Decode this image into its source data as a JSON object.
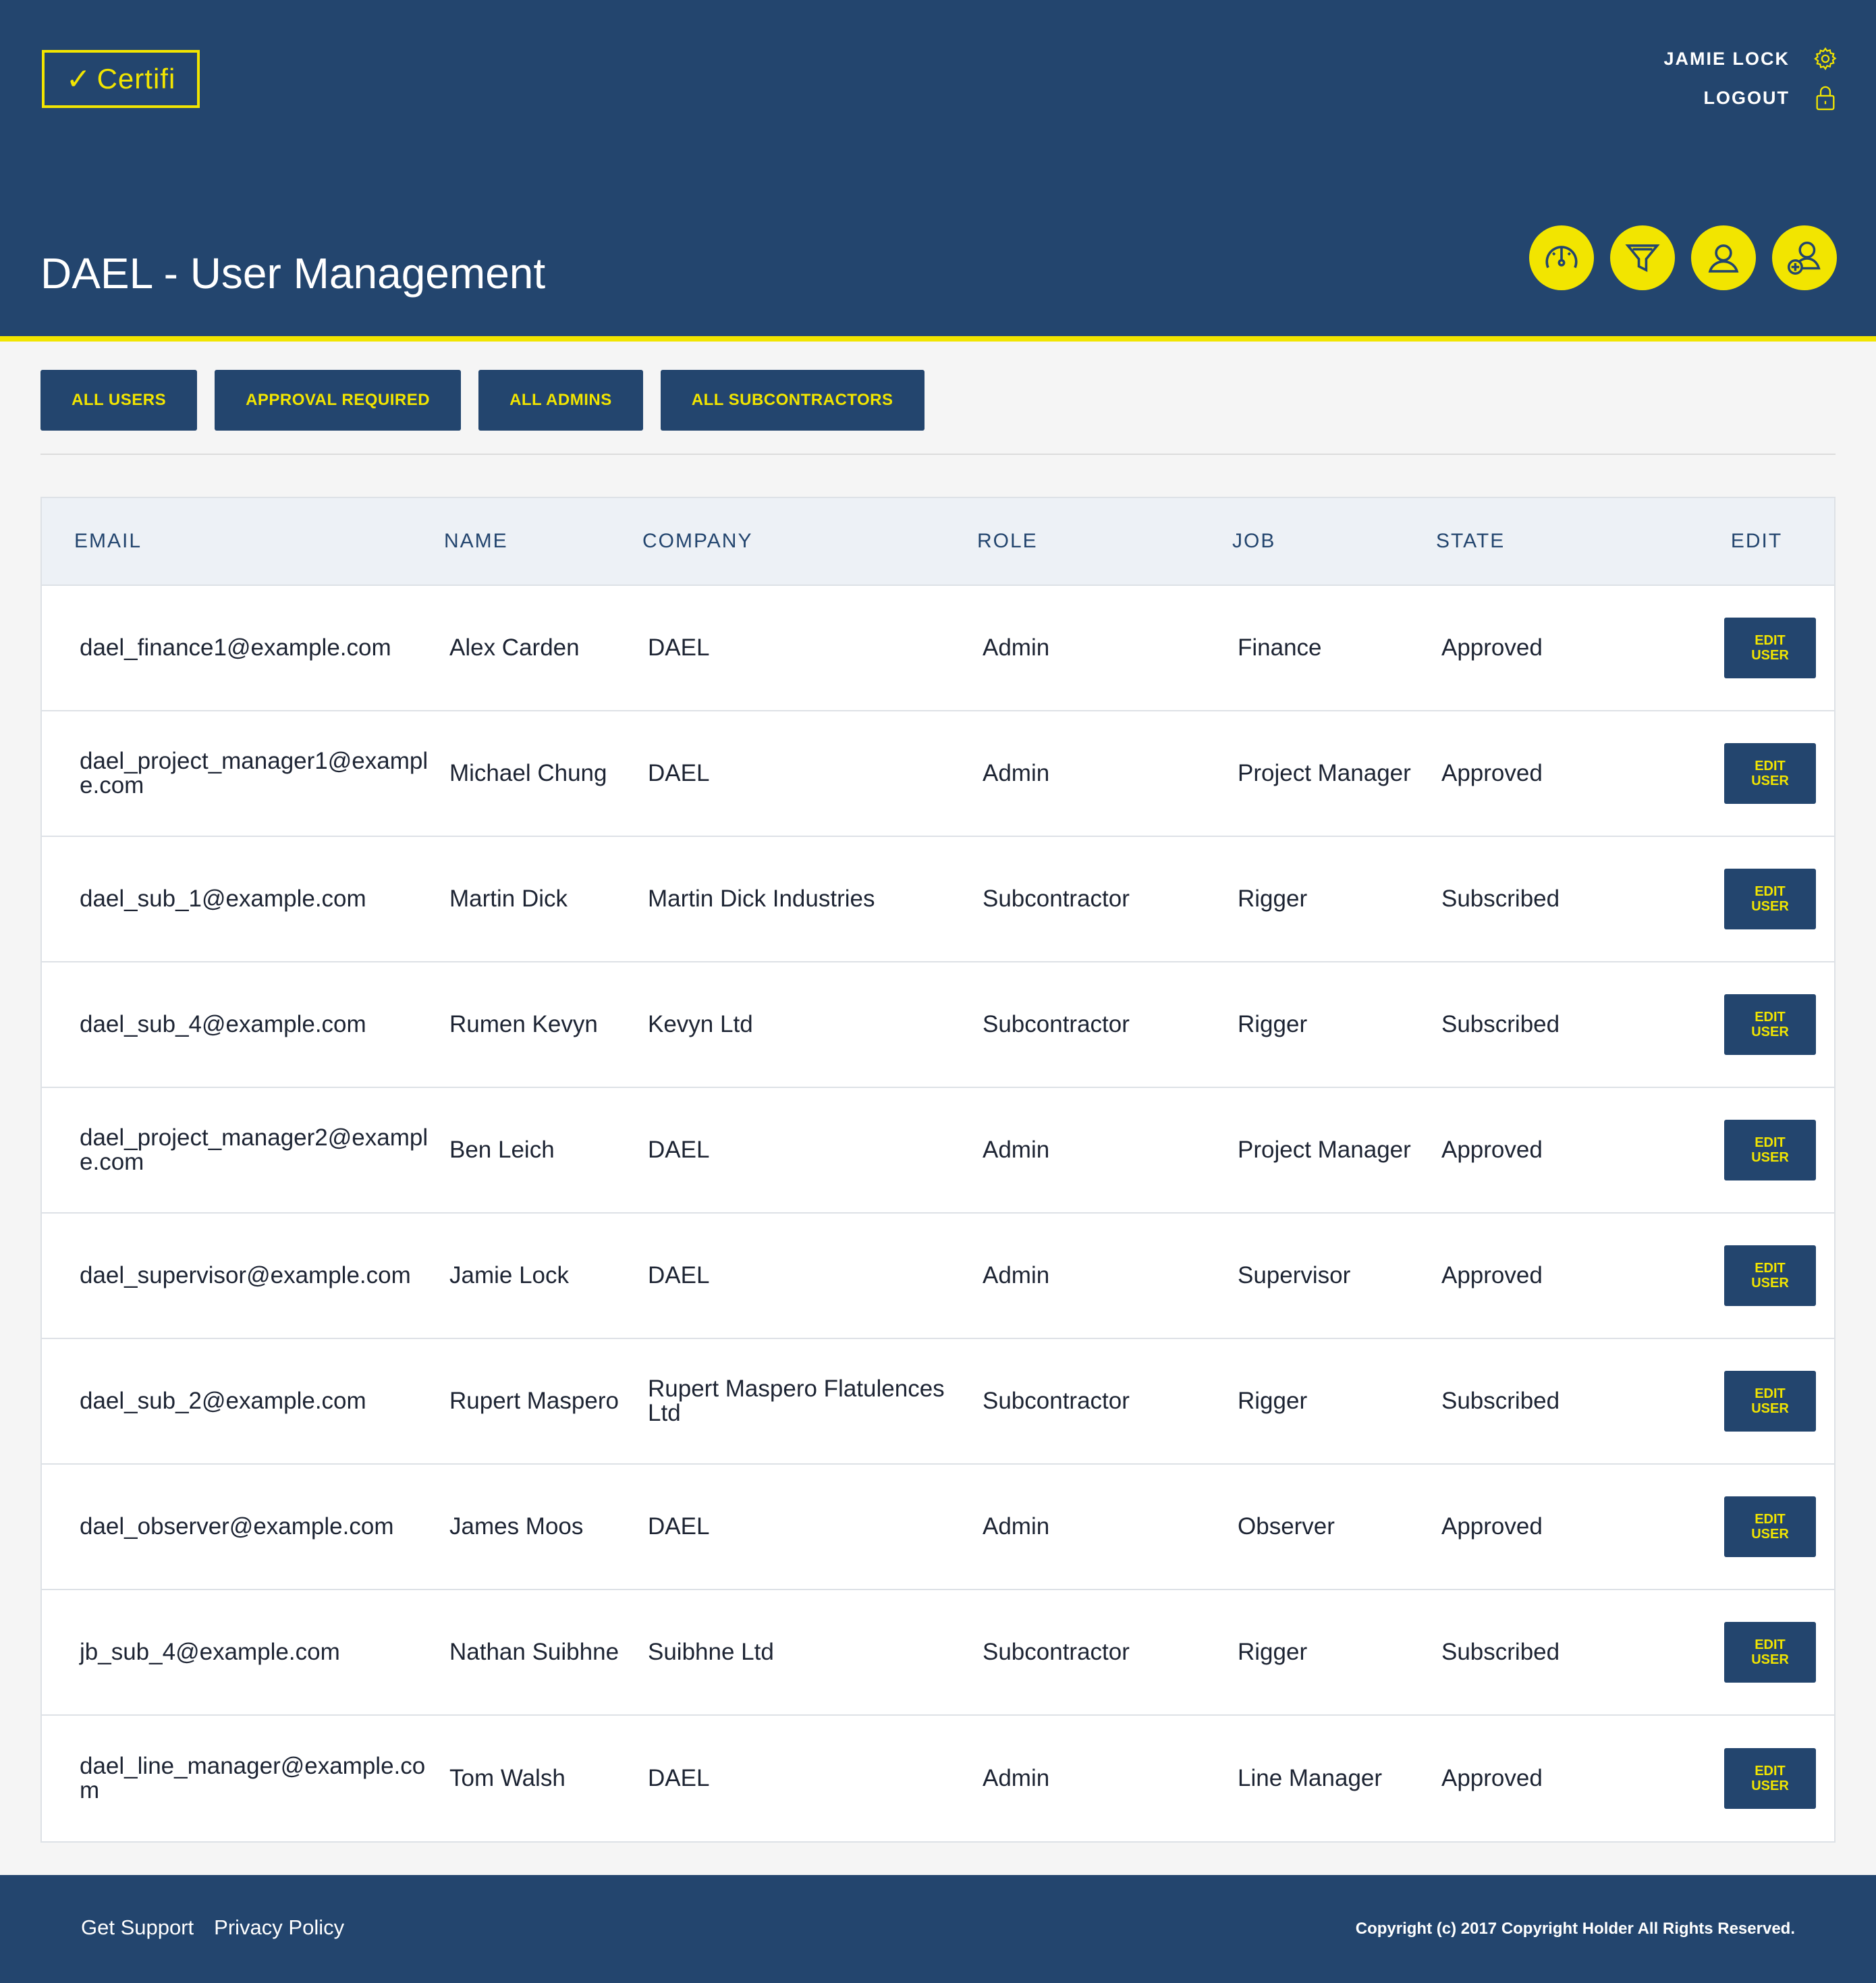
{
  "brand": {
    "logo_text": "Certifi",
    "accent": "#f2e500",
    "primary": "#23456e"
  },
  "user_menu": {
    "username": "JAMIE LOCK",
    "logout": "LOGOUT"
  },
  "page_title": "DAEL - User Management",
  "header_icons": [
    "dashboard-icon",
    "filter-icon",
    "user-icon",
    "add-user-icon"
  ],
  "tabs": [
    "ALL USERS",
    "APPROVAL REQUIRED",
    "ALL ADMINS",
    "ALL SUBCONTRACTORS"
  ],
  "table": {
    "headers": {
      "email": "EMAIL",
      "name": "NAME",
      "company": "COMPANY",
      "role": "ROLE",
      "job": "JOB",
      "state": "STATE",
      "edit": "EDIT"
    },
    "edit_label_1": "EDIT",
    "edit_label_2": "USER",
    "rows": [
      {
        "email": "dael_finance1@example.com",
        "name": "Alex Carden",
        "company": "DAEL",
        "role": "Admin",
        "job": "Finance",
        "state": "Approved"
      },
      {
        "email": "dael_project_manager1@example.com",
        "name": "Michael Chung",
        "company": "DAEL",
        "role": "Admin",
        "job": "Project Manager",
        "state": "Approved"
      },
      {
        "email": "dael_sub_1@example.com",
        "name": "Martin Dick",
        "company": "Martin Dick Industries",
        "role": "Subcontractor",
        "job": "Rigger",
        "state": "Subscribed"
      },
      {
        "email": "dael_sub_4@example.com",
        "name": "Rumen Kevyn",
        "company": "Kevyn Ltd",
        "role": "Subcontractor",
        "job": "Rigger",
        "state": "Subscribed"
      },
      {
        "email": "dael_project_manager2@example.com",
        "name": "Ben Leich",
        "company": "DAEL",
        "role": "Admin",
        "job": "Project Manager",
        "state": "Approved"
      },
      {
        "email": "dael_supervisor@example.com",
        "name": "Jamie Lock",
        "company": "DAEL",
        "role": "Admin",
        "job": "Supervisor",
        "state": "Approved"
      },
      {
        "email": "dael_sub_2@example.com",
        "name": "Rupert Maspero",
        "company": "Rupert Maspero Flatulences Ltd",
        "role": "Subcontractor",
        "job": "Rigger",
        "state": "Subscribed"
      },
      {
        "email": "dael_observer@example.com",
        "name": "James Moos",
        "company": "DAEL",
        "role": "Admin",
        "job": "Observer",
        "state": "Approved"
      },
      {
        "email": "jb_sub_4@example.com",
        "name": "Nathan Suibhne",
        "company": "Suibhne Ltd",
        "role": "Subcontractor",
        "job": "Rigger",
        "state": "Subscribed"
      },
      {
        "email": "dael_line_manager@example.com",
        "name": "Tom Walsh",
        "company": "DAEL",
        "role": "Admin",
        "job": "Line Manager",
        "state": "Approved"
      }
    ]
  },
  "footer": {
    "links": [
      "Get Support",
      "Privacy Policy"
    ],
    "copyright": "Copyright (c) 2017 Copyright Holder All Rights Reserved."
  }
}
